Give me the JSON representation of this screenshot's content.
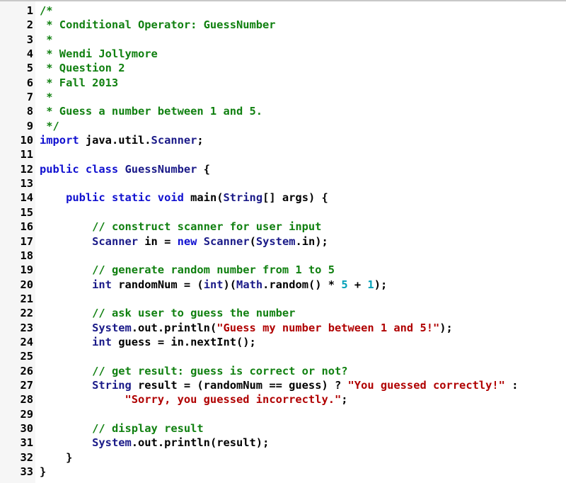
{
  "editor": {
    "language": "java",
    "colors": {
      "comment": "#108010",
      "keyword": "#1010d0",
      "type": "#1a1a88",
      "string": "#b00000",
      "number": "#00a0b8",
      "plain": "#000000"
    },
    "lines": [
      {
        "n": "1",
        "tokens": [
          [
            "c",
            "/*"
          ]
        ]
      },
      {
        "n": "2",
        "tokens": [
          [
            "c",
            " * Conditional Operator: GuessNumber"
          ]
        ]
      },
      {
        "n": "3",
        "tokens": [
          [
            "c",
            " *"
          ]
        ]
      },
      {
        "n": "4",
        "tokens": [
          [
            "c",
            " * Wendi Jollymore"
          ]
        ]
      },
      {
        "n": "5",
        "tokens": [
          [
            "c",
            " * Question 2"
          ]
        ]
      },
      {
        "n": "6",
        "tokens": [
          [
            "c",
            " * Fall 2013"
          ]
        ]
      },
      {
        "n": "7",
        "tokens": [
          [
            "c",
            " *"
          ]
        ]
      },
      {
        "n": "8",
        "tokens": [
          [
            "c",
            " * Guess a number between 1 and 5."
          ]
        ]
      },
      {
        "n": "9",
        "tokens": [
          [
            "c",
            " */"
          ]
        ]
      },
      {
        "n": "10",
        "tokens": [
          [
            "k",
            "import"
          ],
          [
            "p",
            " java.util."
          ],
          [
            "t",
            "Scanner"
          ],
          [
            "p",
            ";"
          ]
        ]
      },
      {
        "n": "11",
        "tokens": []
      },
      {
        "n": "12",
        "tokens": [
          [
            "k",
            "public class "
          ],
          [
            "t",
            "GuessNumber"
          ],
          [
            "p",
            " {"
          ]
        ]
      },
      {
        "n": "13",
        "tokens": []
      },
      {
        "n": "14",
        "tokens": [
          [
            "p",
            "    "
          ],
          [
            "k",
            "public static void"
          ],
          [
            "p",
            " main("
          ],
          [
            "t",
            "String"
          ],
          [
            "p",
            "[] args) {"
          ]
        ]
      },
      {
        "n": "15",
        "tokens": []
      },
      {
        "n": "16",
        "tokens": [
          [
            "p",
            "        "
          ],
          [
            "c",
            "// construct scanner for user input"
          ]
        ]
      },
      {
        "n": "17",
        "tokens": [
          [
            "p",
            "        "
          ],
          [
            "t",
            "Scanner"
          ],
          [
            "p",
            " in = "
          ],
          [
            "k",
            "new"
          ],
          [
            "p",
            " "
          ],
          [
            "t",
            "Scanner"
          ],
          [
            "p",
            "("
          ],
          [
            "t",
            "System"
          ],
          [
            "p",
            ".in);"
          ]
        ]
      },
      {
        "n": "18",
        "tokens": []
      },
      {
        "n": "19",
        "tokens": [
          [
            "p",
            "        "
          ],
          [
            "c",
            "// generate random number from 1 to 5"
          ]
        ]
      },
      {
        "n": "20",
        "tokens": [
          [
            "p",
            "        "
          ],
          [
            "t",
            "int"
          ],
          [
            "p",
            " randomNum = ("
          ],
          [
            "t",
            "int"
          ],
          [
            "p",
            ")("
          ],
          [
            "t",
            "Math"
          ],
          [
            "p",
            ".random() * "
          ],
          [
            "n",
            "5"
          ],
          [
            "p",
            " + "
          ],
          [
            "n",
            "1"
          ],
          [
            "p",
            ");"
          ]
        ]
      },
      {
        "n": "21",
        "tokens": []
      },
      {
        "n": "22",
        "tokens": [
          [
            "p",
            "        "
          ],
          [
            "c",
            "// ask user to guess the number"
          ]
        ]
      },
      {
        "n": "23",
        "tokens": [
          [
            "p",
            "        "
          ],
          [
            "t",
            "System"
          ],
          [
            "p",
            ".out.println("
          ],
          [
            "s",
            "\"Guess my number between 1 and 5!\""
          ],
          [
            "p",
            ");"
          ]
        ]
      },
      {
        "n": "24",
        "tokens": [
          [
            "p",
            "        "
          ],
          [
            "t",
            "int"
          ],
          [
            "p",
            " guess = in.nextInt();"
          ]
        ]
      },
      {
        "n": "25",
        "tokens": []
      },
      {
        "n": "26",
        "tokens": [
          [
            "p",
            "        "
          ],
          [
            "c",
            "// get result: guess is correct or not?"
          ]
        ]
      },
      {
        "n": "27",
        "tokens": [
          [
            "p",
            "        "
          ],
          [
            "t",
            "String"
          ],
          [
            "p",
            " result = (randomNum == guess) ? "
          ],
          [
            "s",
            "\"You guessed correctly!\""
          ],
          [
            "p",
            " :"
          ]
        ]
      },
      {
        "n": "28",
        "tokens": [
          [
            "p",
            "             "
          ],
          [
            "s",
            "\"Sorry, you guessed incorrectly.\""
          ],
          [
            "p",
            ";"
          ]
        ]
      },
      {
        "n": "29",
        "tokens": []
      },
      {
        "n": "30",
        "tokens": [
          [
            "p",
            "        "
          ],
          [
            "c",
            "// display result"
          ]
        ]
      },
      {
        "n": "31",
        "tokens": [
          [
            "p",
            "        "
          ],
          [
            "t",
            "System"
          ],
          [
            "p",
            ".out.println(result);"
          ]
        ]
      },
      {
        "n": "32",
        "tokens": [
          [
            "p",
            "    }"
          ]
        ]
      },
      {
        "n": "33",
        "tokens": [
          [
            "p",
            "}"
          ]
        ]
      }
    ]
  }
}
